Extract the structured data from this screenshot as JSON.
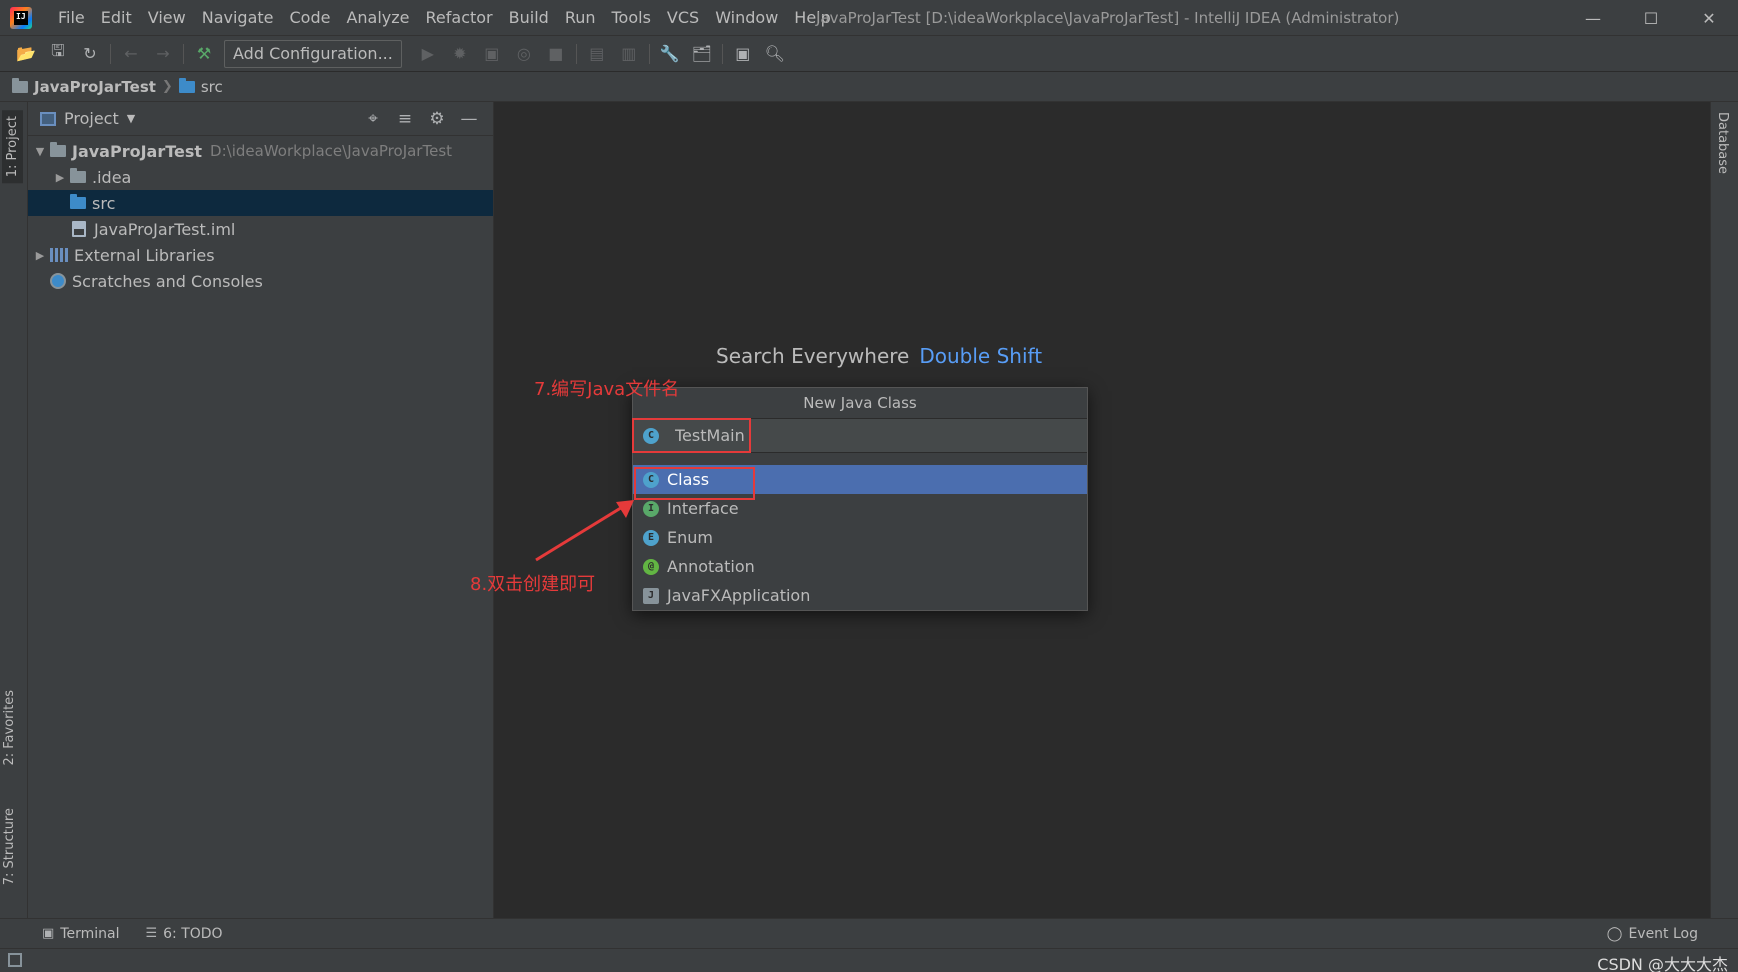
{
  "app": {
    "window_title": "JavaProJarTest [D:\\ideaWorkplace\\JavaProJarTest] - IntelliJ IDEA (Administrator)"
  },
  "menu": [
    "File",
    "Edit",
    "View",
    "Navigate",
    "Code",
    "Analyze",
    "Refactor",
    "Build",
    "Run",
    "Tools",
    "VCS",
    "Window",
    "Help"
  ],
  "toolbar": {
    "add_config_label": "Add Configuration..."
  },
  "breadcrumb": {
    "project": "JavaProJarTest",
    "folder": "src"
  },
  "left_strip": {
    "project_tab": "1: Project",
    "favorites_tab": "2: Favorites",
    "structure_tab": "7: Structure"
  },
  "right_strip": {
    "database_tab": "Database"
  },
  "project_panel": {
    "title": "Project",
    "tree": {
      "root_name": "JavaProJarTest",
      "root_path": "D:\\ideaWorkplace\\JavaProJarTest",
      "idea": ".idea",
      "src": "src",
      "iml": "JavaProJarTest.iml",
      "external_libraries": "External Libraries",
      "scratches": "Scratches and Consoles"
    }
  },
  "editor": {
    "search_hint": "Search Everywhere",
    "search_key": "Double Shift"
  },
  "dialog": {
    "title": "New Java Class",
    "name_value": "TestMain",
    "kinds": [
      "Class",
      "Interface",
      "Enum",
      "Annotation",
      "JavaFXApplication"
    ],
    "selected_kind": "Class"
  },
  "annotations": {
    "step7": "7.编写Java文件名",
    "step8": "8.双击创建即可"
  },
  "bottom_bar": {
    "terminal": "Terminal",
    "todo": "6: TODO",
    "event_log": "Event Log"
  },
  "status_bar": {
    "watermark": "CSDN @大大大杰"
  },
  "colors": {
    "accent": "#4b6eaf",
    "annotation_red": "#e53a3a",
    "link_blue": "#589df6",
    "selection_dark": "#0d293e"
  }
}
